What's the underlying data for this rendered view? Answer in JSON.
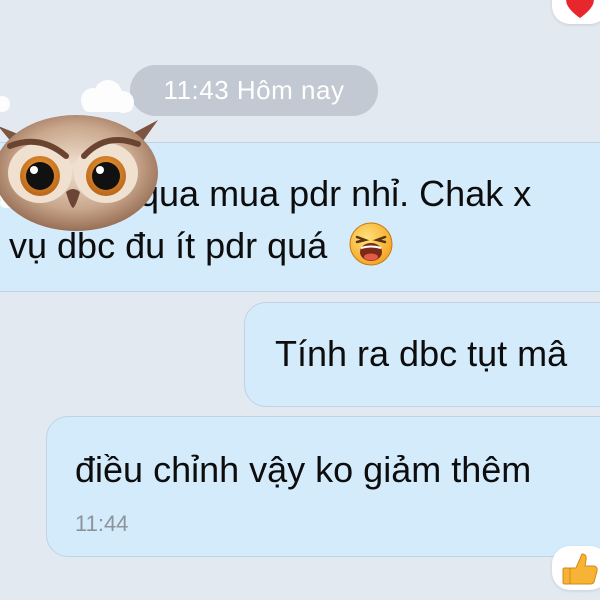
{
  "header": {
    "timestamp": "11:43 Hôm nay"
  },
  "messages": [
    {
      "line_1": "qua mua pdr nhỉ. Chak x",
      "line_2": "vụ dbc đu ít pdr quá",
      "emoji": "laughing-face-icon"
    },
    {
      "text": "Tính ra dbc tụt mâ"
    },
    {
      "text": "điều chỉnh vậy ko giảm thêm",
      "time": "11:44",
      "reaction": "thumbs-up-icon"
    }
  ],
  "reactions": {
    "top": "heart-icon",
    "bottom": "thumbs-up-icon"
  },
  "sticker": "owl-sticker",
  "colors": {
    "background": "#e3e9f1",
    "bubble": "#d4ebfb",
    "bubble_border": "#bfd3e3",
    "pill": "#c3c9d2",
    "time_text": "#8d939b",
    "heart": "#e8262e",
    "like": "#f6b335"
  }
}
